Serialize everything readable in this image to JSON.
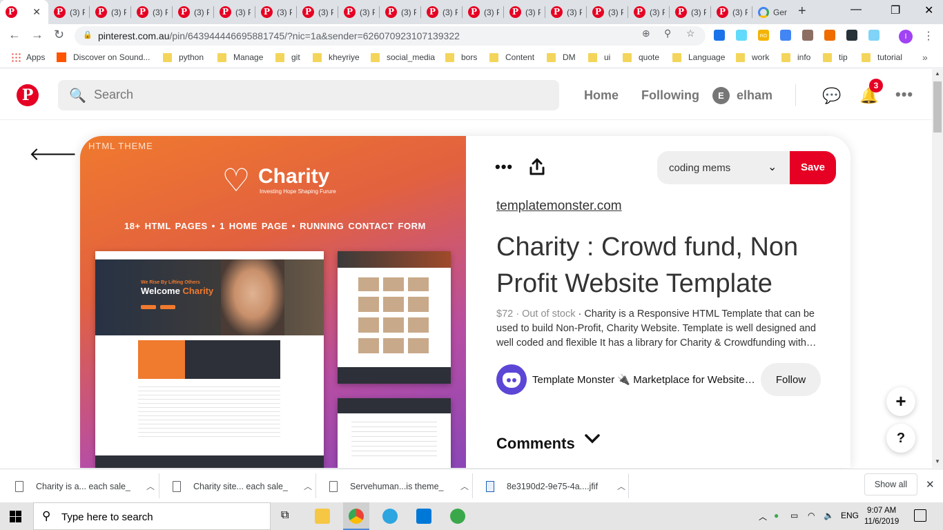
{
  "browser": {
    "tabs": [
      {
        "label": "",
        "active": true,
        "icon": "pinterest-icon"
      },
      {
        "label": "(3) P",
        "icon": "pinterest-icon"
      },
      {
        "label": "(3) P",
        "icon": "pinterest-icon"
      },
      {
        "label": "(3) P",
        "icon": "pinterest-icon"
      },
      {
        "label": "(3) P",
        "icon": "pinterest-icon"
      },
      {
        "label": "(3) P",
        "icon": "pinterest-icon"
      },
      {
        "label": "(3) P",
        "icon": "pinterest-icon"
      },
      {
        "label": "(3) P",
        "icon": "pinterest-icon"
      },
      {
        "label": "(3) P",
        "icon": "pinterest-icon"
      },
      {
        "label": "(3) P",
        "icon": "pinterest-icon"
      },
      {
        "label": "(3) P",
        "icon": "pinterest-icon"
      },
      {
        "label": "(3) P",
        "icon": "pinterest-icon"
      },
      {
        "label": "(3) P",
        "icon": "pinterest-icon"
      },
      {
        "label": "(3) P",
        "icon": "pinterest-icon"
      },
      {
        "label": "(3) P",
        "icon": "pinterest-icon"
      },
      {
        "label": "(3) P",
        "icon": "pinterest-icon"
      },
      {
        "label": "(3) P",
        "icon": "pinterest-icon"
      },
      {
        "label": "(3) P",
        "icon": "pinterest-icon"
      },
      {
        "label": "Ger",
        "icon": "google-icon"
      }
    ],
    "url_host": "pinterest.com.au",
    "url_path": "/pin/643944446695881745/?nic=1a&sender=626070923107139322",
    "bookmarks": [
      "Apps",
      "Discover on Sound...",
      "python",
      "Manage",
      "git",
      "kheyriye",
      "social_media",
      "bors",
      "Content",
      "DM",
      "ui",
      "quote",
      "Language",
      "work",
      "info",
      "tip",
      "tutorial"
    ],
    "profile_initial": "I",
    "extension_badge": "RO"
  },
  "pinterest": {
    "search_placeholder": "Search",
    "nav": {
      "home": "Home",
      "following": "Following",
      "user_initial": "E",
      "user_name": "elham"
    },
    "notification_count": "3"
  },
  "pin": {
    "image": {
      "tag": "HTML THEME",
      "logo": "Charity",
      "slogan": "Investing Hope Shaping Furure",
      "features": "18+ HTML PAGES  •  1 HOME PAGE  •  RUNNING CONTACT FORM",
      "hero_line1": "We Rise By Lifting Others",
      "hero_line2": "Welcome ",
      "hero_line2_accent": "Charity"
    },
    "board": "coding mems",
    "save_label": "Save",
    "domain": "templatemonster.com",
    "title": "Charity : Crowd fund, Non Profit Website Template",
    "price": "$72",
    "stock": " · Out of stock",
    "description": " · Charity is a Responsive HTML Template that can be used to build Non-Profit, Charity Website. Template is well designed and well coded and flexible It has a library for Charity & Crowdfunding with…",
    "creator": "Template Monster 🔌 Marketplace for Website Templates",
    "follow_label": "Follow",
    "comments_label": "Comments"
  },
  "downloads": {
    "items": [
      "Charity is a... each sale_",
      "Charity site... each sale_",
      "Servehuman...is theme_",
      "8e3190d2-9e75-4a....jfif"
    ],
    "show_all": "Show all"
  },
  "taskbar": {
    "search_placeholder": "Type here to search",
    "language": "ENG",
    "time": "9:07 AM",
    "date": "11/6/2019"
  },
  "colors": {
    "pinterest_red": "#e60023",
    "tab_strip": "#dee1e6"
  }
}
